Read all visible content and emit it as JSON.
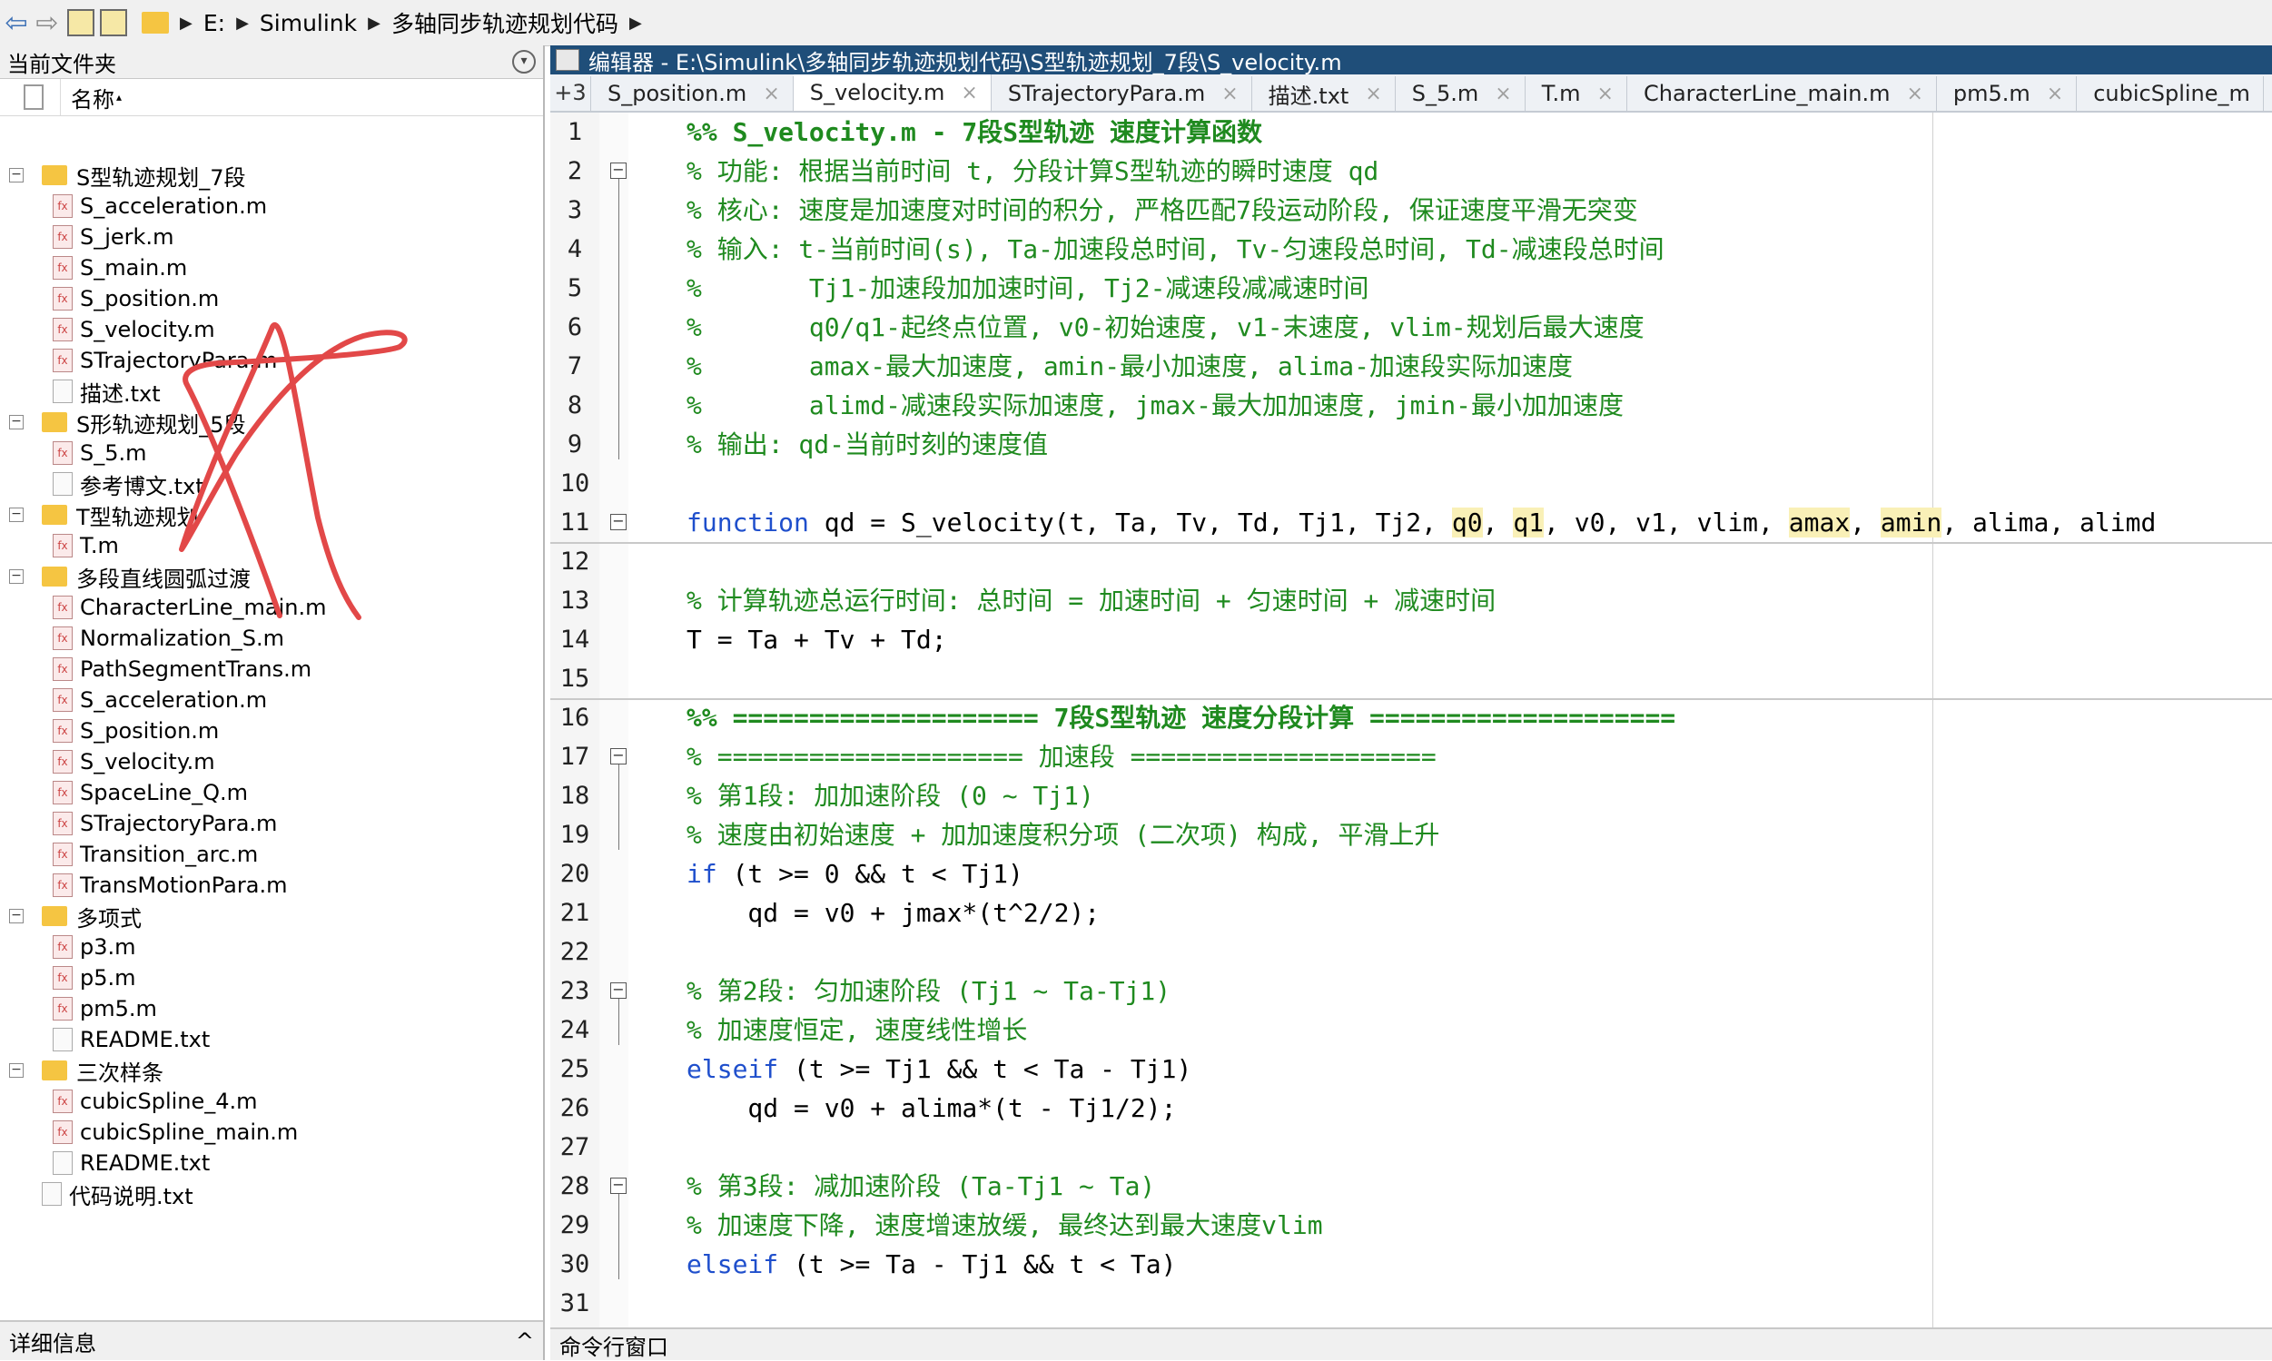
{
  "address_bar": {
    "crumbs": [
      "E:",
      "Simulink",
      "多轴同步轨迹规划代码"
    ]
  },
  "file_panel": {
    "title": "当前文件夹",
    "column_name": "名称",
    "sort_marker": "▴",
    "footer_label": "详细信息",
    "footer_toggle": "^",
    "items": [
      {
        "label": "S型轨迹规划_7段",
        "kind": "folder",
        "level": 0
      },
      {
        "label": "S_acceleration.m",
        "kind": "m",
        "level": 1
      },
      {
        "label": "S_jerk.m",
        "kind": "m",
        "level": 1
      },
      {
        "label": "S_main.m",
        "kind": "m",
        "level": 1
      },
      {
        "label": "S_position.m",
        "kind": "m",
        "level": 1
      },
      {
        "label": "S_velocity.m",
        "kind": "m",
        "level": 1
      },
      {
        "label": "STrajectoryPara.m",
        "kind": "m",
        "level": 1
      },
      {
        "label": "描述.txt",
        "kind": "txt",
        "level": 1
      },
      {
        "label": "S形轨迹规划_5段",
        "kind": "folder",
        "level": 0
      },
      {
        "label": "S_5.m",
        "kind": "m",
        "level": 1
      },
      {
        "label": "参考博文.txt",
        "kind": "txt",
        "level": 1
      },
      {
        "label": "T型轨迹规划",
        "kind": "folder",
        "level": 0
      },
      {
        "label": "T.m",
        "kind": "m",
        "level": 1
      },
      {
        "label": "多段直线圆弧过渡",
        "kind": "folder",
        "level": 0
      },
      {
        "label": "CharacterLine_main.m",
        "kind": "m",
        "level": 1
      },
      {
        "label": "Normalization_S.m",
        "kind": "m",
        "level": 1
      },
      {
        "label": "PathSegmentTrans.m",
        "kind": "m",
        "level": 1
      },
      {
        "label": "S_acceleration.m",
        "kind": "m",
        "level": 1
      },
      {
        "label": "S_position.m",
        "kind": "m",
        "level": 1
      },
      {
        "label": "S_velocity.m",
        "kind": "m",
        "level": 1
      },
      {
        "label": "SpaceLine_Q.m",
        "kind": "m",
        "level": 1
      },
      {
        "label": "STrajectoryPara.m",
        "kind": "m",
        "level": 1
      },
      {
        "label": "Transition_arc.m",
        "kind": "m",
        "level": 1
      },
      {
        "label": "TransMotionPara.m",
        "kind": "m",
        "level": 1
      },
      {
        "label": "多项式",
        "kind": "folder",
        "level": 0
      },
      {
        "label": "p3.m",
        "kind": "m",
        "level": 1
      },
      {
        "label": "p5.m",
        "kind": "m",
        "level": 1
      },
      {
        "label": "pm5.m",
        "kind": "m",
        "level": 1
      },
      {
        "label": "README.txt",
        "kind": "txt",
        "level": 1
      },
      {
        "label": "三次样条",
        "kind": "folder",
        "level": 0
      },
      {
        "label": "cubicSpline_4.m",
        "kind": "m",
        "level": 1
      },
      {
        "label": "cubicSpline_main.m",
        "kind": "m",
        "level": 1
      },
      {
        "label": "README.txt",
        "kind": "txt",
        "level": 1
      },
      {
        "label": "代码说明.txt",
        "kind": "txt",
        "level": 0
      }
    ]
  },
  "editor": {
    "title": "编辑器 - E:\\Simulink\\多轴同步轨迹规划代码\\S型轨迹规划_7段\\S_velocity.m",
    "more_tabs": "+3",
    "tabs": [
      {
        "label": "S_position.m",
        "active": false
      },
      {
        "label": "S_velocity.m",
        "active": true
      },
      {
        "label": "STrajectoryPara.m",
        "active": false
      },
      {
        "label": "描述.txt",
        "active": false
      },
      {
        "label": "S_5.m",
        "active": false
      },
      {
        "label": "T.m",
        "active": false
      },
      {
        "label": "CharacterLine_main.m",
        "active": false
      },
      {
        "label": "pm5.m",
        "active": false
      },
      {
        "label": "cubicSpline_m",
        "active": false
      }
    ],
    "lines": [
      "%% S_velocity.m - 7段S型轨迹 速度计算函数",
      "% 功能: 根据当前时间 t, 分段计算S型轨迹的瞬时速度 qd",
      "% 核心: 速度是加速度对时间的积分, 严格匹配7段运动阶段, 保证速度平滑无突变",
      "% 输入: t-当前时间(s), Ta-加速段总时间, Tv-匀速段总时间, Td-减速段总时间",
      "%       Tj1-加速段加加速时间, Tj2-减速段减减速时间",
      "%       q0/q1-起终点位置, v0-初始速度, v1-末速度, vlim-规划后最大速度",
      "%       amax-最大加速度, amin-最小加速度, alima-加速段实际加速度",
      "%       alimd-减速段实际加速度, jmax-最大加加速度, jmin-最小加加速度",
      "% 输出: qd-当前时刻的速度值",
      "",
      "function qd = S_velocity(t, Ta, Tv, Td, Tj1, Tj2, q0, q1, v0, v1, vlim, amax, amin, alima, alimd",
      "",
      "% 计算轨迹总运行时间: 总时间 = 加速时间 + 匀速时间 + 减速时间",
      "T = Ta + Tv + Td;",
      "",
      "%% ==================== 7段S型轨迹 速度分段计算 ====================",
      "% ==================== 加速段 ====================",
      "% 第1段: 加加速阶段 (0 ~ Tj1)",
      "% 速度由初始速度 + 加加速度积分项 (二次项) 构成, 平滑上升",
      "if (t >= 0 && t < Tj1)",
      "    qd = v0 + jmax*(t^2/2);",
      "",
      "% 第2段: 匀加速阶段 (Tj1 ~ Ta-Tj1)",
      "% 加速度恒定, 速度线性增长",
      "elseif (t >= Tj1 && t < Ta - Tj1)",
      "    qd = v0 + alima*(t - Tj1/2);",
      "",
      "% 第3段: 减加速阶段 (Ta-Tj1 ~ Ta)",
      "% 加速度下降, 速度增速放缓, 最终达到最大速度vlim",
      "elseif (t >= Ta - Tj1 && t < Ta)",
      ""
    ]
  },
  "command_window": {
    "title": "命令行窗口"
  }
}
